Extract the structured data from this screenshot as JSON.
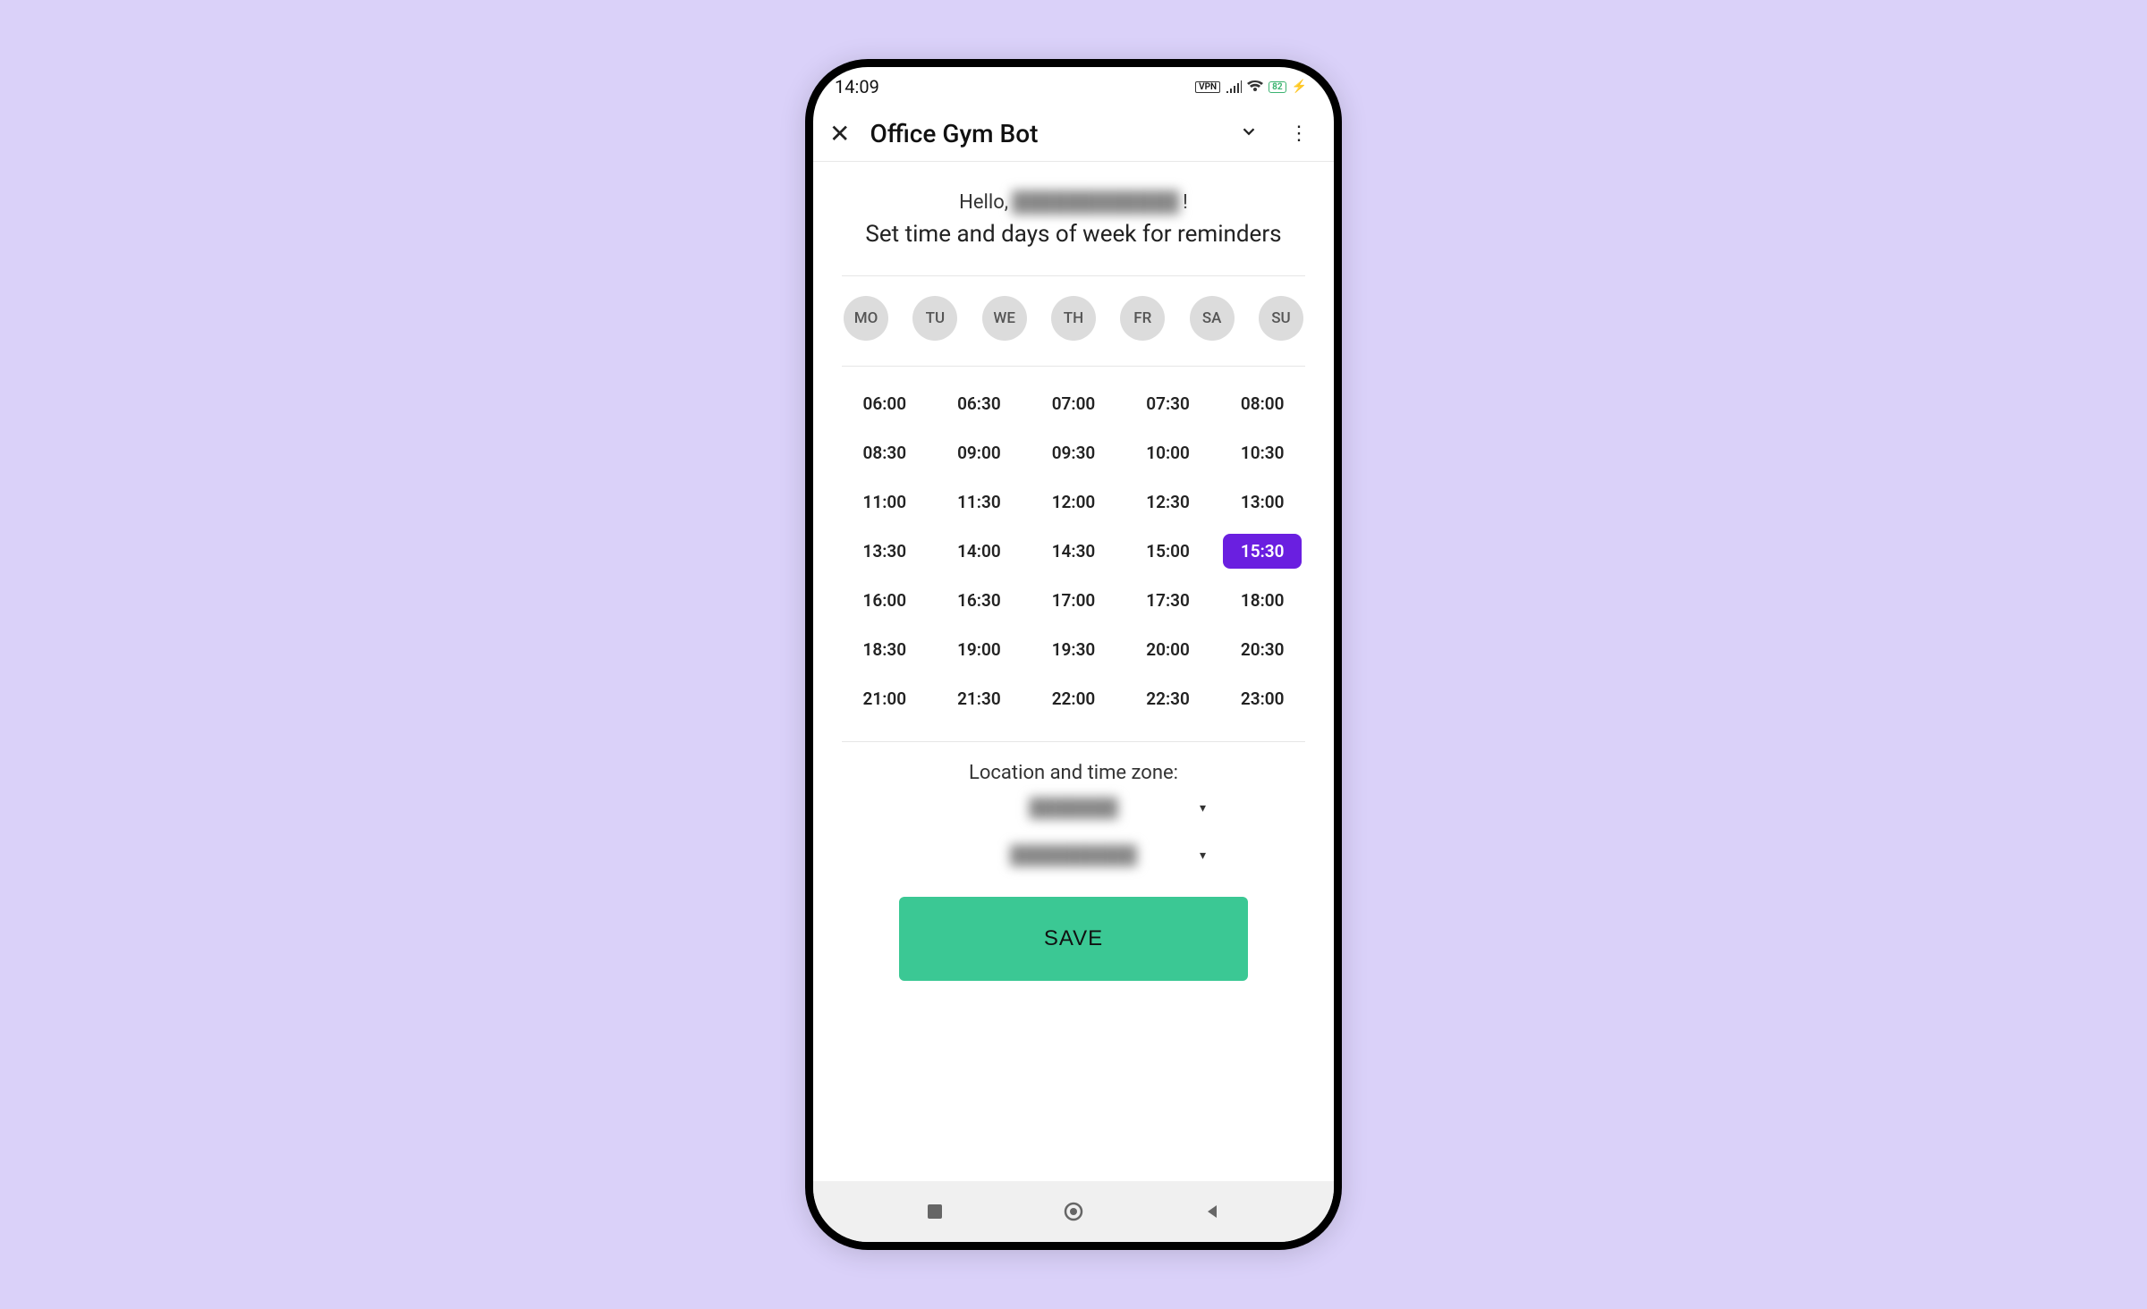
{
  "status": {
    "time": "14:09",
    "vpn": "VPN",
    "battery": "82"
  },
  "appbar": {
    "title": "Office Gym Bot"
  },
  "greeting": {
    "prefix": "Hello,",
    "name": "████████████",
    "suffix": "!"
  },
  "subtitle": "Set time and days of week for reminders",
  "days": [
    "MO",
    "TU",
    "WE",
    "TH",
    "FR",
    "SA",
    "SU"
  ],
  "times": [
    "06:00",
    "06:30",
    "07:00",
    "07:30",
    "08:00",
    "08:30",
    "09:00",
    "09:30",
    "10:00",
    "10:30",
    "11:00",
    "11:30",
    "12:00",
    "12:30",
    "13:00",
    "13:30",
    "14:00",
    "14:30",
    "15:00",
    "15:30",
    "16:00",
    "16:30",
    "17:00",
    "17:30",
    "18:00",
    "18:30",
    "19:00",
    "19:30",
    "20:00",
    "20:30",
    "21:00",
    "21:30",
    "22:00",
    "22:30",
    "23:00"
  ],
  "selected_time": "15:30",
  "tz_label": "Location and time zone:",
  "location": "███████",
  "timezone": "██████████",
  "save_label": "SAVE"
}
